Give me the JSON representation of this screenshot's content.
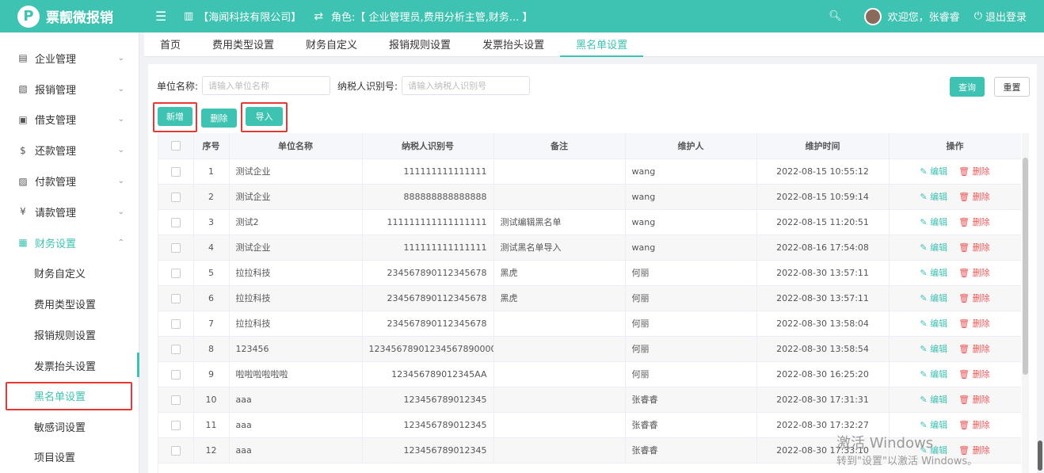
{
  "app": {
    "logo_letter": "P",
    "name": "票靓微报销"
  },
  "header": {
    "menu_icon": "hamburger-icon",
    "company": "【海闻科技有限公司】",
    "role": "角色:【 企业管理员,费用分析主管,财务... 】",
    "welcome": "欢迎您，张睿睿",
    "logout": "退出登录"
  },
  "sidebar": {
    "items": [
      {
        "label": "企业管理",
        "icon": "building-icon"
      },
      {
        "label": "报销管理",
        "icon": "receipt-icon"
      },
      {
        "label": "借支管理",
        "icon": "ledger-icon"
      },
      {
        "label": "还款管理",
        "icon": "dollar-icon"
      },
      {
        "label": "付款管理",
        "icon": "payment-icon"
      },
      {
        "label": "请款管理",
        "icon": "yen-icon"
      },
      {
        "label": "财务设置",
        "icon": "finance-icon"
      }
    ],
    "sub_items": [
      "财务自定义",
      "费用类型设置",
      "报销规则设置",
      "发票抬头设置",
      "黑名单设置",
      "敏感词设置",
      "项目设置"
    ]
  },
  "tabs": [
    "首页",
    "费用类型设置",
    "财务自定义",
    "报销规则设置",
    "发票抬头设置",
    "黑名单设置"
  ],
  "filter": {
    "company_label": "单位名称:",
    "company_placeholder": "请输入单位名称",
    "tax_label": "纳税人识别号:",
    "tax_placeholder": "请输入纳税人识别号",
    "query": "查询",
    "reset": "重置"
  },
  "actions": {
    "add": "新增",
    "delete": "删除",
    "import": "导入"
  },
  "table": {
    "headers": [
      "序号",
      "单位名称",
      "纳税人识别号",
      "备注",
      "维护人",
      "维护时间",
      "操作"
    ],
    "edit_label": "编辑",
    "delete_label": "删除",
    "rows": [
      {
        "no": "1",
        "name": "测试企业",
        "tax": "111111111111111",
        "note": "",
        "maintainer": "wang",
        "time": "2022-08-15 10:55:12"
      },
      {
        "no": "2",
        "name": "测试企业",
        "tax": "888888888888888",
        "note": "",
        "maintainer": "wang",
        "time": "2022-08-15 10:59:14"
      },
      {
        "no": "3",
        "name": "测试2",
        "tax": "111111111111111111",
        "note": "测试编辑黑名单",
        "maintainer": "wang",
        "time": "2022-08-15 11:20:51"
      },
      {
        "no": "4",
        "name": "测试企业",
        "tax": "111111111111111",
        "note": "测试黑名单导入",
        "maintainer": "wang",
        "time": "2022-08-16 17:54:08"
      },
      {
        "no": "5",
        "name": "拉拉科技",
        "tax": "234567890112345678",
        "note": "黑虎",
        "maintainer": "何丽",
        "time": "2022-08-30 13:57:11"
      },
      {
        "no": "6",
        "name": "拉拉科技",
        "tax": "234567890112345678",
        "note": "黑虎",
        "maintainer": "何丽",
        "time": "2022-08-30 13:57:11"
      },
      {
        "no": "7",
        "name": "拉拉科技",
        "tax": "234567890112345678",
        "note": "",
        "maintainer": "何丽",
        "time": "2022-08-30 13:58:04"
      },
      {
        "no": "8",
        "name": "123456",
        "tax": "12345678901234567890000",
        "note": "",
        "maintainer": "何丽",
        "time": "2022-08-30 13:58:54"
      },
      {
        "no": "9",
        "name": "啦啦啦啦啦啦",
        "tax": "123456789012345AA",
        "note": "",
        "maintainer": "何丽",
        "time": "2022-08-30 16:25:20"
      },
      {
        "no": "10",
        "name": "aaa",
        "tax": "123456789012345",
        "note": "",
        "maintainer": "张睿睿",
        "time": "2022-08-30 17:31:31"
      },
      {
        "no": "11",
        "name": "aaa",
        "tax": "123456789012345",
        "note": "",
        "maintainer": "张睿睿",
        "time": "2022-08-30 17:32:27"
      },
      {
        "no": "12",
        "name": "aaa",
        "tax": "123456789012345",
        "note": "",
        "maintainer": "张睿睿",
        "time": "2022-08-30 17:33:10"
      }
    ]
  },
  "watermark": {
    "line1": "激活 Windows",
    "line2": "转到\"设置\"以激活 Windows。"
  },
  "colors": {
    "brand": "#3ec2b1",
    "delete": "#e85858",
    "highlight": "#e53935"
  }
}
